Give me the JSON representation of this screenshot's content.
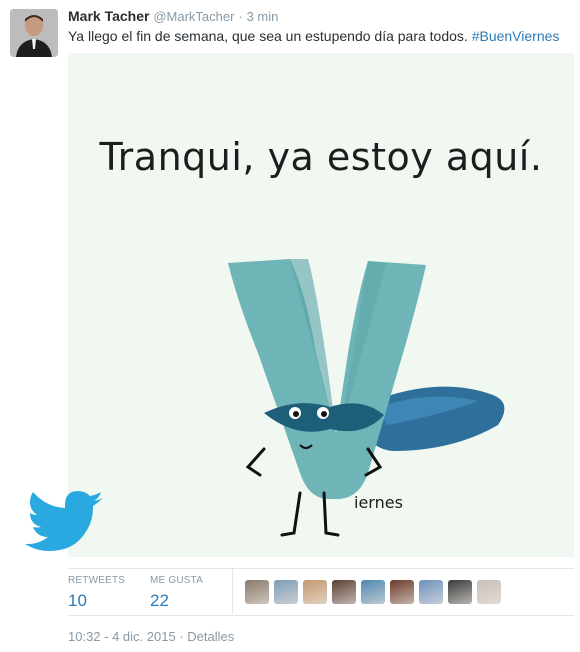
{
  "tweet": {
    "author_name": "Mark Tacher",
    "handle": "@MarkTacher",
    "separator": "·",
    "time": "3 min",
    "text": "Ya llego el fin de semana, que sea un estupendo día para todos.",
    "hashtag": "#BuenViernes"
  },
  "media": {
    "caption": "Tranqui, ya estoy aquí.",
    "word": "iernes"
  },
  "stats": {
    "retweets_label": "RETWEETS",
    "retweets_value": "10",
    "likes_label": "ME GUSTA",
    "likes_value": "22"
  },
  "favoriters": [
    {
      "color": "#8a7a6a"
    },
    {
      "color": "#7d9cb6"
    },
    {
      "color": "#c49a70"
    },
    {
      "color": "#5a4034"
    },
    {
      "color": "#4f88b0"
    },
    {
      "color": "#6b3a2a"
    },
    {
      "color": "#6d93bd"
    },
    {
      "color": "#3b3b3b"
    },
    {
      "color": "#c9c0b8"
    }
  ],
  "footer": {
    "timestamp": "10:32 - 4 dic. 2015",
    "separator": "·",
    "details_link": "Detalles"
  },
  "colors": {
    "link": "#2b7bb9",
    "muted": "#8899a6",
    "twitter_blue": "#2aa9e0",
    "v_teal": "#6fb5b7",
    "cape_blue": "#2f6f9c"
  },
  "icons": {
    "bird": "twitter-bird-icon"
  }
}
